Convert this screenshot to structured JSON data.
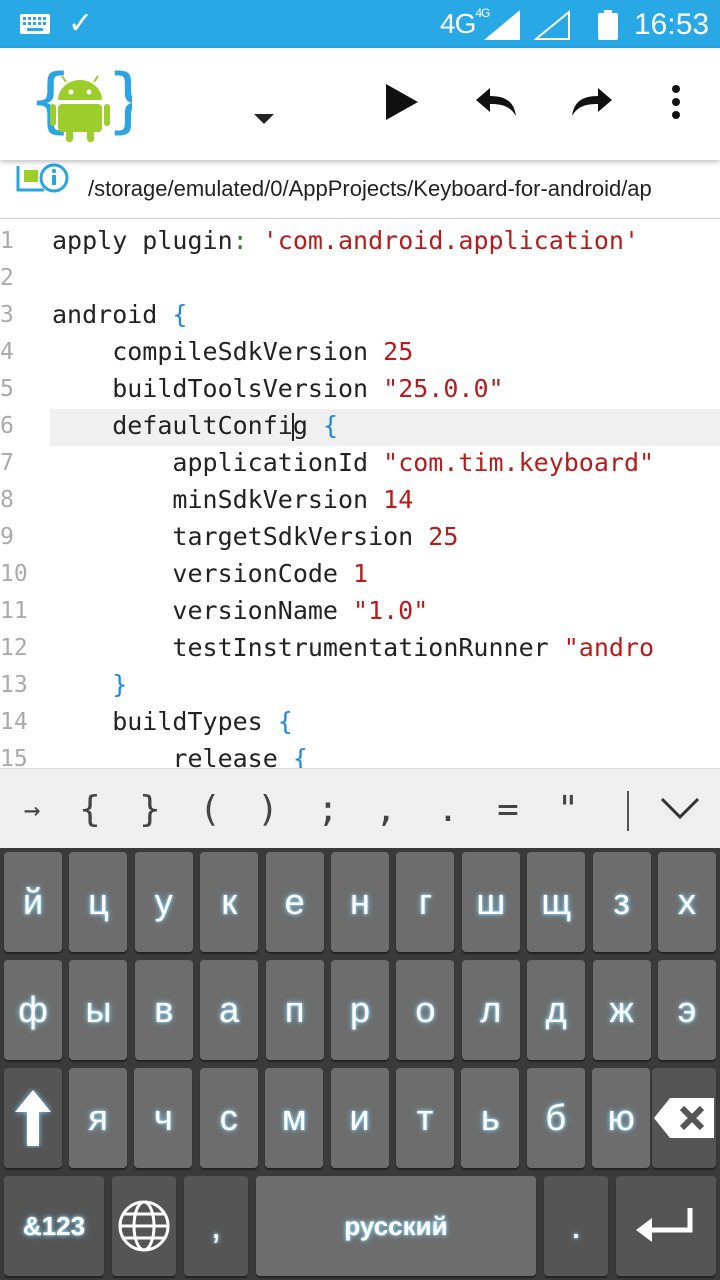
{
  "status_bar": {
    "network": "4G",
    "network_sup": "4G",
    "time": "16:53",
    "icons": [
      "keyboard-icon",
      "check-icon",
      "signal-icon",
      "battery-icon"
    ]
  },
  "toolbar": {
    "icons": [
      "aide-logo-icon",
      "dropdown-arrow-icon",
      "run-icon",
      "undo-icon",
      "redo-icon",
      "overflow-menu-icon"
    ]
  },
  "file_path": "/storage/emulated/0/AppProjects/Keyboard-for-android/ap",
  "editor": {
    "lines": [
      {
        "n": "1",
        "parts": [
          [
            "apply plugin",
            ""
          ],
          [
            ":",
            "pun"
          ],
          [
            " ",
            ""
          ],
          [
            "'com.android.application'",
            "str"
          ]
        ]
      },
      {
        "n": "2",
        "parts": []
      },
      {
        "n": "3",
        "parts": [
          [
            "android ",
            ""
          ],
          [
            "{",
            "br"
          ]
        ]
      },
      {
        "n": "4",
        "parts": [
          [
            "    compileSdkVersion ",
            ""
          ],
          [
            "25",
            "num"
          ]
        ]
      },
      {
        "n": "5",
        "parts": [
          [
            "    buildToolsVersion ",
            ""
          ],
          [
            "\"25.0.0\"",
            "str"
          ]
        ]
      },
      {
        "n": "6",
        "parts": [
          [
            "    defaultConfi",
            ""
          ],
          [
            "|",
            "caret"
          ],
          [
            "g ",
            ""
          ],
          [
            "{",
            "br"
          ]
        ],
        "current": true
      },
      {
        "n": "7",
        "parts": [
          [
            "        applicationId ",
            ""
          ],
          [
            "\"com.tim.keyboard\"",
            "str"
          ]
        ]
      },
      {
        "n": "8",
        "parts": [
          [
            "        minSdkVersion ",
            ""
          ],
          [
            "14",
            "num"
          ]
        ]
      },
      {
        "n": "9",
        "parts": [
          [
            "        targetSdkVersion ",
            ""
          ],
          [
            "25",
            "num"
          ]
        ]
      },
      {
        "n": "10",
        "parts": [
          [
            "        versionCode ",
            ""
          ],
          [
            "1",
            "num"
          ]
        ]
      },
      {
        "n": "11",
        "parts": [
          [
            "        versionName ",
            ""
          ],
          [
            "\"1.0\"",
            "str"
          ]
        ]
      },
      {
        "n": "12",
        "parts": [
          [
            "        testInstrumentationRunner ",
            ""
          ],
          [
            "\"andro",
            "str"
          ]
        ]
      },
      {
        "n": "13",
        "parts": [
          [
            "    ",
            ""
          ],
          [
            "}",
            "br"
          ]
        ]
      },
      {
        "n": "14",
        "parts": [
          [
            "    buildTypes ",
            ""
          ],
          [
            "{",
            "br"
          ]
        ]
      },
      {
        "n": "15",
        "parts": [
          [
            "        release ",
            ""
          ],
          [
            "{",
            "br"
          ]
        ]
      }
    ]
  },
  "symbol_bar": [
    "→",
    "{",
    "}",
    "(",
    ")",
    ";",
    ",",
    ".",
    "=",
    "\""
  ],
  "keyboard": {
    "row1": [
      "й",
      "ц",
      "у",
      "к",
      "е",
      "н",
      "г",
      "ш",
      "щ",
      "з",
      "х"
    ],
    "row2": [
      "ф",
      "ы",
      "в",
      "а",
      "п",
      "р",
      "о",
      "л",
      "д",
      "ж",
      "э"
    ],
    "row3": [
      "я",
      "ч",
      "с",
      "м",
      "и",
      "т",
      "ь",
      "б",
      "ю"
    ],
    "mode_key": "&123",
    "comma_key": ",",
    "space_key": "русский",
    "period_key": ".",
    "colors": {
      "key": "#6d6d6d",
      "bg": "#3a3a3a",
      "glow": "#7fd4ff"
    }
  }
}
